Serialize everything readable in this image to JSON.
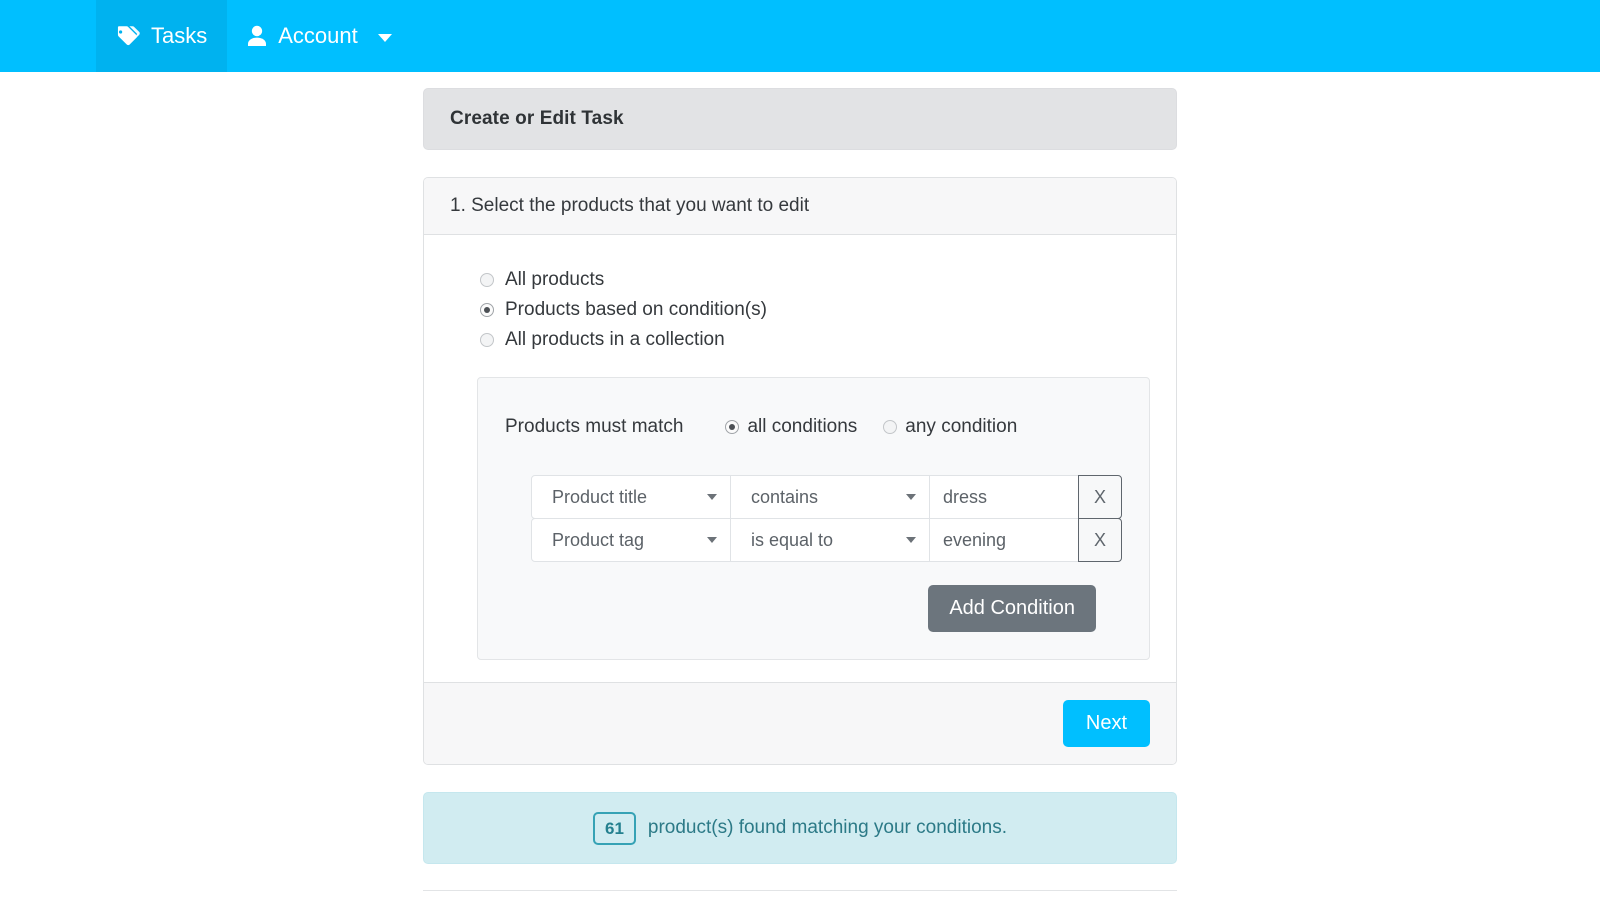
{
  "navbar": {
    "brand_color": "#00bfff",
    "items": [
      {
        "label": "Tasks",
        "icon": "tag-icon",
        "active": true
      },
      {
        "label": "Account",
        "icon": "user-icon",
        "active": false,
        "has_caret": true
      }
    ]
  },
  "title_panel": {
    "heading": "Create or Edit Task"
  },
  "panel": {
    "heading": "1. Select the products that you want to edit",
    "product_scope": {
      "options": [
        {
          "label": "All products",
          "checked": false
        },
        {
          "label": "Products based on condition(s)",
          "checked": true
        },
        {
          "label": "All products in a collection",
          "checked": false
        }
      ]
    },
    "condition_box": {
      "match_label": "Products must match",
      "match_options": [
        {
          "label": "all conditions",
          "checked": true
        },
        {
          "label": "any condition",
          "checked": false
        }
      ],
      "rows": [
        {
          "field": "Product title",
          "operator": "contains",
          "value": "dress",
          "remove_label": "X"
        },
        {
          "field": "Product tag",
          "operator": "is equal to",
          "value": "evening",
          "remove_label": "X"
        }
      ],
      "add_condition_label": "Add Condition"
    },
    "footer": {
      "next_label": "Next"
    }
  },
  "alert": {
    "count": "61",
    "message": "product(s) found matching your conditions.",
    "background": "#d1ecf1",
    "accent": "#24808f"
  }
}
